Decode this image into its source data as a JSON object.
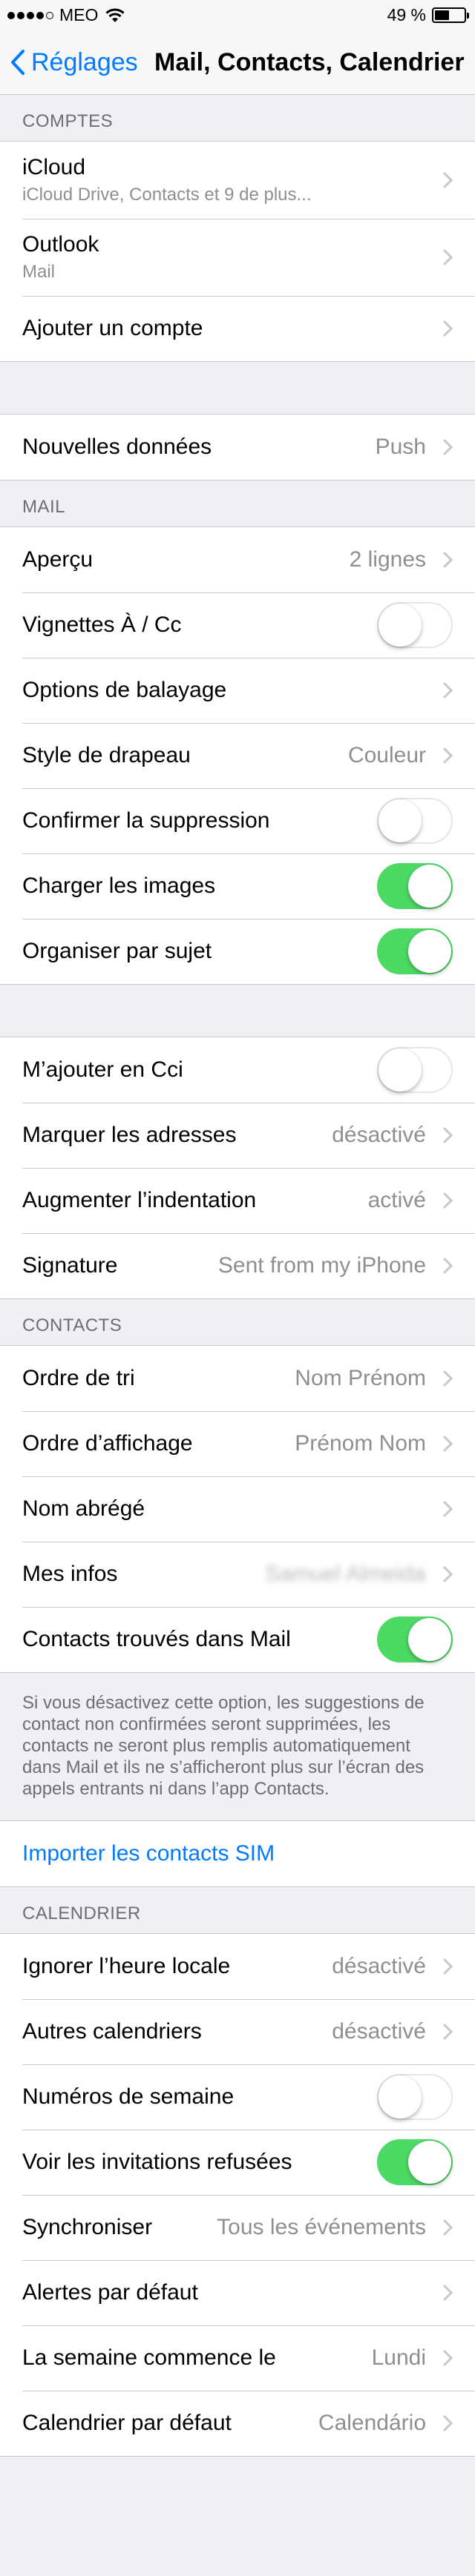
{
  "status": {
    "carrier": "MEO",
    "battery_text": "49 %",
    "battery_level": 0.49
  },
  "nav": {
    "back_label": "Réglages",
    "title": "Mail, Contacts, Calendrier"
  },
  "accounts": {
    "header": "COMPTES",
    "items": [
      {
        "label": "iCloud",
        "sub": "iCloud Drive, Contacts et 9 de plus..."
      },
      {
        "label": "Outlook",
        "sub": "Mail"
      },
      {
        "label": "Ajouter un compte"
      }
    ]
  },
  "fetch": {
    "label": "Nouvelles données",
    "value": "Push"
  },
  "mail": {
    "header": "MAIL",
    "preview": {
      "label": "Aperçu",
      "value": "2 lignes"
    },
    "to_cc": {
      "label": "Vignettes À / Cc",
      "on": false
    },
    "swipe": {
      "label": "Options de balayage"
    },
    "flag_style": {
      "label": "Style de drapeau",
      "value": "Couleur"
    },
    "ask_delete": {
      "label": "Confirmer la suppression",
      "on": false
    },
    "load_images": {
      "label": "Charger les images",
      "on": true
    },
    "thread": {
      "label": "Organiser par sujet",
      "on": true
    }
  },
  "mail_more": {
    "bcc": {
      "label": "M’ajouter en Cci",
      "on": false
    },
    "mark_addresses": {
      "label": "Marquer les adresses",
      "value": "désactivé"
    },
    "indent": {
      "label": "Augmenter l’indentation",
      "value": "activé"
    },
    "signature": {
      "label": "Signature",
      "value": "Sent from my iPhone"
    }
  },
  "contacts": {
    "header": "CONTACTS",
    "sort": {
      "label": "Ordre de tri",
      "value": "Nom Prénom"
    },
    "display": {
      "label": "Ordre d’affichage",
      "value": "Prénom Nom"
    },
    "short_name": {
      "label": "Nom abrégé"
    },
    "my_info": {
      "label": "Mes infos",
      "value": "Samuel Almeida"
    },
    "found_in_mail": {
      "label": "Contacts trouvés dans Mail",
      "on": true
    },
    "footer": "Si vous désactivez cette option, les suggestions de contact non confirmées seront supprimées, les contacts ne seront plus remplis automatiquement dans Mail et ils ne s’afficheront plus sur l’écran des appels entrants ni dans l’app Contacts."
  },
  "import_sim": {
    "label": "Importer les contacts SIM"
  },
  "calendar": {
    "header": "CALENDRIER",
    "tz_override": {
      "label": "Ignorer l’heure locale",
      "value": "désactivé"
    },
    "alt_calendars": {
      "label": "Autres calendriers",
      "value": "désactivé"
    },
    "week_numbers": {
      "label": "Numéros de semaine",
      "on": false
    },
    "declined": {
      "label": "Voir les invitations refusées",
      "on": true
    },
    "sync": {
      "label": "Synchroniser",
      "value": "Tous les événements"
    },
    "default_alerts": {
      "label": "Alertes par défaut"
    },
    "week_start": {
      "label": "La semaine commence le",
      "value": "Lundi"
    },
    "default_calendar": {
      "label": "Calendrier par défaut",
      "value": "Calendário"
    }
  },
  "colors": {
    "accent": "#007aff",
    "toggle_on": "#4cd964",
    "background": "#efeff4"
  },
  "icons": [
    "back-chevron-icon",
    "chevron-right-icon",
    "wifi-icon",
    "battery-icon",
    "signal-icon"
  ]
}
